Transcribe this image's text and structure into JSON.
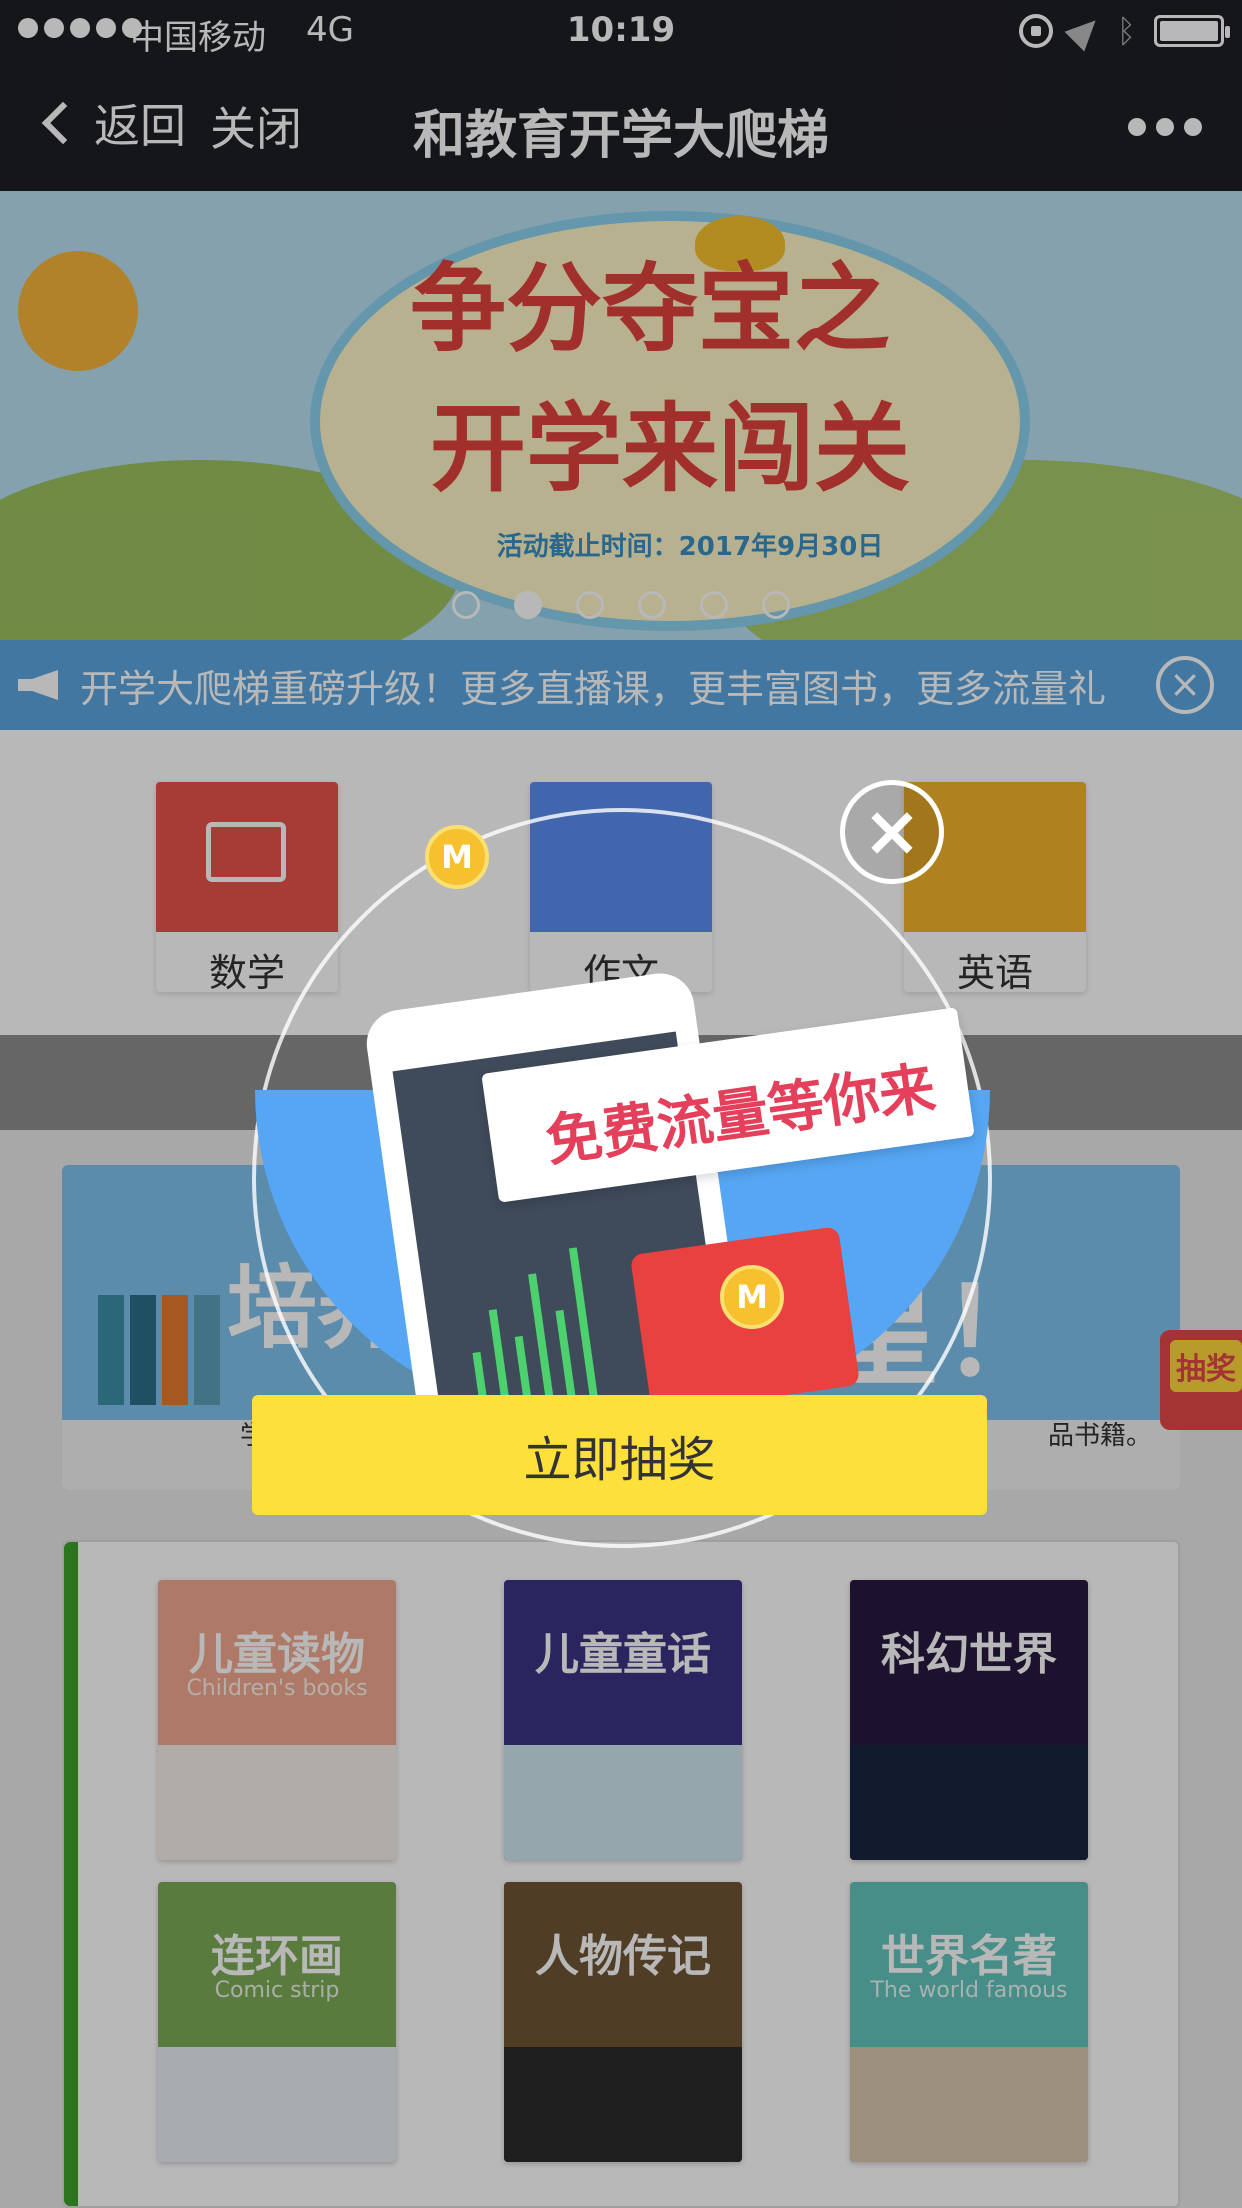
{
  "status_bar": {
    "carrier": "中国移动",
    "network": "4G",
    "time": "10:19"
  },
  "nav": {
    "back_label": "返回",
    "close_label": "关闭",
    "title": "和教育开学大爬梯"
  },
  "banner": {
    "headline_1": "争分夺宝之",
    "headline_2": "开学来闯关",
    "deadline": "活动截止时间：2017年9月30日",
    "slide_count": 6,
    "active_slide": 2
  },
  "notice": {
    "text": "开学大爬梯重磅升级！更多直播课，更丰富图书，更多流量礼"
  },
  "subjects": [
    {
      "label": "数学",
      "color": "#e8524b"
    },
    {
      "label": "作文",
      "color": "#5b8ef0"
    },
    {
      "label": "英语",
      "color": "#f4b42c"
    }
  ],
  "promo": {
    "caption_left": "学做",
    "caption_right": "品书籍。",
    "big_text_left": "培养",
    "big_text_right": "星！"
  },
  "lottery_tab": {
    "label": "抽奖"
  },
  "book_categories": [
    {
      "title": "儿童读物",
      "subtitle": "Children's books",
      "color": "#f2a98f"
    },
    {
      "title": "儿童童话",
      "subtitle": "",
      "color": "#3b3284"
    },
    {
      "title": "科幻世界",
      "subtitle": "",
      "color": "#271a3f"
    },
    {
      "title": "连环画",
      "subtitle": "Comic strip",
      "color": "#7dab57"
    },
    {
      "title": "人物传记",
      "subtitle": "",
      "color": "#6f5534"
    },
    {
      "title": "世界名著",
      "subtitle": "The world famous",
      "color": "#63c5bd"
    }
  ],
  "modal": {
    "headline": "免费流量等你来",
    "coin_letter": "M",
    "button_label": "立即抽奖"
  }
}
